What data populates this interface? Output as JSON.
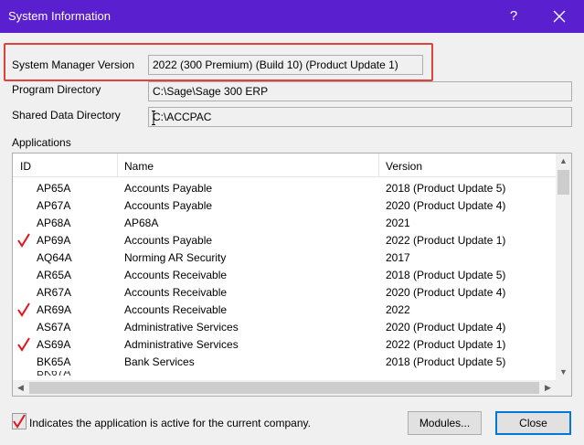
{
  "window": {
    "title": "System Information",
    "help_glyph": "?"
  },
  "fields": {
    "sm_version_label": "System Manager Version",
    "sm_version_value": "2022 (300 Premium) (Build 10) (Product Update 1)",
    "program_dir_label": "Program Directory",
    "program_dir_value": "C:\\Sage\\Sage 300 ERP",
    "shared_dir_label": "Shared Data Directory",
    "shared_dir_value": "C:\\ACCPAC"
  },
  "applications": {
    "label": "Applications",
    "columns": {
      "id": "ID",
      "name": "Name",
      "version": "Version"
    },
    "rows": [
      {
        "active": false,
        "id": "AP65A",
        "name": "Accounts Payable",
        "version": "2018 (Product Update 5)"
      },
      {
        "active": false,
        "id": "AP67A",
        "name": "Accounts Payable",
        "version": "2020 (Product Update 4)"
      },
      {
        "active": false,
        "id": "AP68A",
        "name": "AP68A",
        "version": "2021"
      },
      {
        "active": true,
        "id": "AP69A",
        "name": "Accounts Payable",
        "version": "2022 (Product Update 1)"
      },
      {
        "active": false,
        "id": "AQ64A",
        "name": "Norming AR Security",
        "version": "2017"
      },
      {
        "active": false,
        "id": "AR65A",
        "name": "Accounts Receivable",
        "version": "2018 (Product Update 5)"
      },
      {
        "active": false,
        "id": "AR67A",
        "name": "Accounts Receivable",
        "version": "2020 (Product Update 4)"
      },
      {
        "active": true,
        "id": "AR69A",
        "name": "Accounts Receivable",
        "version": "2022"
      },
      {
        "active": false,
        "id": "AS67A",
        "name": "Administrative Services",
        "version": "2020 (Product Update 4)"
      },
      {
        "active": true,
        "id": "AS69A",
        "name": "Administrative Services",
        "version": "2022 (Product Update 1)"
      },
      {
        "active": false,
        "id": "BK65A",
        "name": "Bank Services",
        "version": "2018 (Product Update 5)"
      }
    ]
  },
  "footer": {
    "legend_text": "Indicates the application is active for the current company.",
    "modules_label": "Modules...",
    "close_label": "Close"
  },
  "colors": {
    "titlebar": "#5a1fcf",
    "check": "#e0141e",
    "highlight_box": "#e0413b",
    "default_button_border": "#0078d7"
  }
}
